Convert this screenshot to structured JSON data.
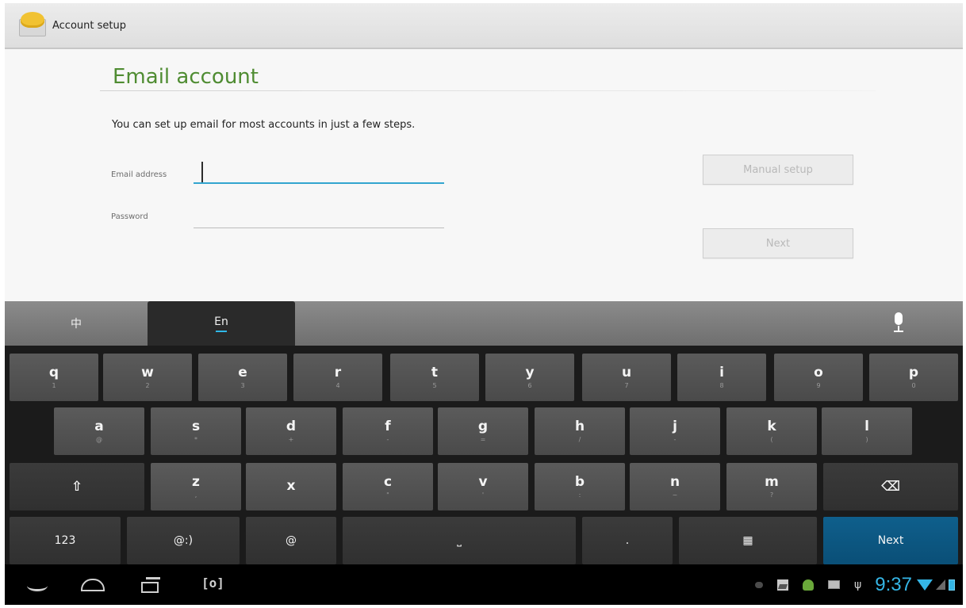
{
  "actionbar": {
    "title": "Account setup",
    "icon": "email-envelope-icon"
  },
  "page": {
    "title": "Email account",
    "intro": "You can set up email for most accounts in just a few steps.",
    "email_label": "Email address",
    "email_value": "",
    "password_label": "Password",
    "password_value": "",
    "manual_setup_label": "Manual setup",
    "next_label": "Next"
  },
  "ime": {
    "tab_chinese": "中",
    "tab_english": "En",
    "active_tab": "En"
  },
  "keyboard": {
    "row1": [
      {
        "label": "q",
        "hint": "1"
      },
      {
        "label": "w",
        "hint": "2"
      },
      {
        "label": "e",
        "hint": "3"
      },
      {
        "label": "r",
        "hint": "4"
      },
      {
        "label": "t",
        "hint": "5"
      },
      {
        "label": "y",
        "hint": "6"
      },
      {
        "label": "u",
        "hint": "7"
      },
      {
        "label": "i",
        "hint": "8"
      },
      {
        "label": "o",
        "hint": "9"
      },
      {
        "label": "p",
        "hint": "0"
      }
    ],
    "row2": [
      {
        "label": "a",
        "hint": "@"
      },
      {
        "label": "s",
        "hint": "*"
      },
      {
        "label": "d",
        "hint": "+"
      },
      {
        "label": "f",
        "hint": "-"
      },
      {
        "label": "g",
        "hint": "="
      },
      {
        "label": "h",
        "hint": "/"
      },
      {
        "label": "j",
        "hint": "-"
      },
      {
        "label": "k",
        "hint": "("
      },
      {
        "label": "l",
        "hint": ")"
      }
    ],
    "row3": [
      {
        "label": "z",
        "hint": ","
      },
      {
        "label": "x",
        "hint": ""
      },
      {
        "label": "c",
        "hint": "\""
      },
      {
        "label": "v",
        "hint": "'"
      },
      {
        "label": "b",
        "hint": ":"
      },
      {
        "label": "n",
        "hint": "~"
      },
      {
        "label": "m",
        "hint": "?"
      }
    ],
    "shift_symbol": "⇧",
    "backspace_symbol": "⌫",
    "numbers_label": "123",
    "emoticon_label": "@:)",
    "at_label": "@",
    "space_symbol": "⎵",
    "period_label": ".",
    "settings_symbol": "▦",
    "action_label": "Next"
  },
  "navbar": {
    "screenshot_label": "[o]",
    "usb_symbol": "ψ",
    "time": "9:37"
  },
  "colors": {
    "title_green": "#4f8c32",
    "focus_blue": "#33a5cf",
    "clock_blue": "#35b6e6",
    "action_key": "#0f5f8c"
  }
}
